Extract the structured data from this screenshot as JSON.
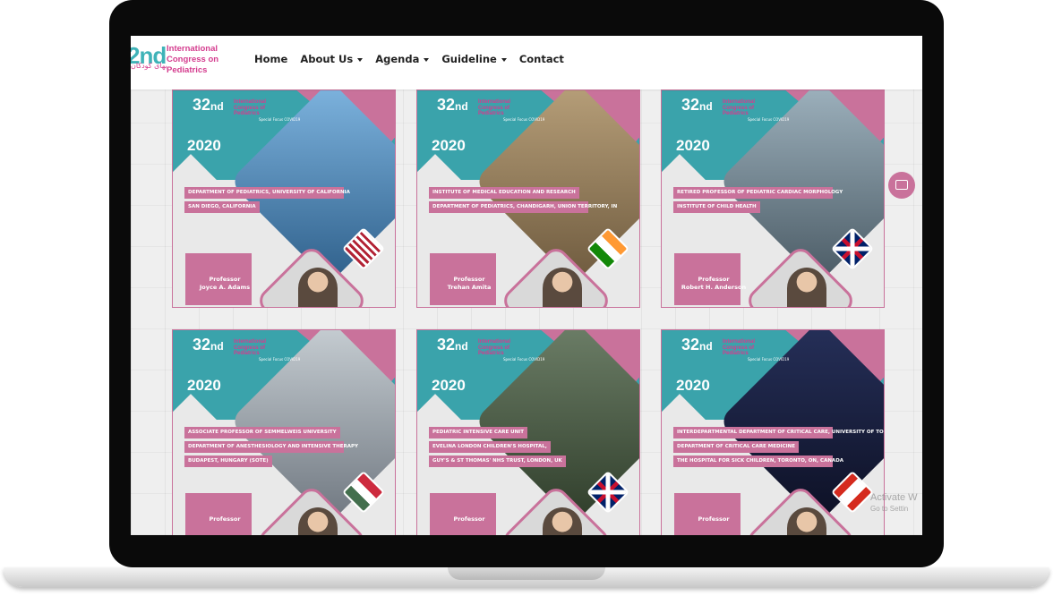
{
  "logo": {
    "number": "2nd",
    "en_lines": "International Congress on Pediatrics",
    "fa_lines": "سی و دومین کنگره بین المللی بیماریهای کودکان"
  },
  "nav": {
    "items": [
      {
        "label": "Home",
        "dropdown": false
      },
      {
        "label": "About Us",
        "dropdown": true
      },
      {
        "label": "Agenda",
        "dropdown": true
      },
      {
        "label": "Guideline",
        "dropdown": true
      },
      {
        "label": "Contact",
        "dropdown": false
      }
    ]
  },
  "cards": [
    {
      "number": "32",
      "ord": "nd",
      "year": "2020",
      "conference": "International Congress of Pediatrics",
      "special": "Special Focus COVID19",
      "dept": [
        "DEPARTMENT OF PEDIATRICS, UNIVERSITY OF CALIFORNIA",
        "SAN DIEGO, CALIFORNIA"
      ],
      "professor_title": "Professor",
      "professor_name": "Joyce A. Adams",
      "flag": "usa-flag",
      "photo_colors": [
        "#7fb5e0",
        "#2e5f8a"
      ]
    },
    {
      "number": "32",
      "ord": "nd",
      "year": "2020",
      "conference": "International Congress of Pediatrics",
      "special": "Special Focus COVID19",
      "dept": [
        "INSTITUTE OF MEDICAL EDUCATION AND RESEARCH",
        "DEPARTMENT OF PEDIATRICS, CHANDIGARH, UNION TERRITORY, IN"
      ],
      "professor_title": "Professor",
      "professor_name": "Trehan Amita",
      "flag": "india-flag",
      "photo_colors": [
        "#b8a07a",
        "#6e5a3e"
      ]
    },
    {
      "number": "32",
      "ord": "nd",
      "year": "2020",
      "conference": "International Congress of Pediatrics",
      "special": "Special Focus COVID19",
      "dept": [
        "RETIRED PROFESSOR OF PEDIATRIC CARDIAC MORPHOLOGY",
        "INSTITUTE OF CHILD HEALTH"
      ],
      "professor_title": "Professor",
      "professor_name": "Robert H. Anderson",
      "flag": "uk-flag",
      "photo_colors": [
        "#9fb3bf",
        "#4a5a64"
      ]
    },
    {
      "number": "32",
      "ord": "nd",
      "year": "2020",
      "conference": "International Congress of Pediatrics",
      "special": "Special Focus COVID19",
      "dept": [
        "ASSOCIATE PROFESSOR OF SEMMELWEIS UNIVERSITY",
        "DEPARTMENT OF ANESTHESIOLOGY AND INTENSIVE THERAPY",
        "BUDAPEST, HUNGARY (SOTE)"
      ],
      "professor_title": "Professor",
      "professor_name": "",
      "flag": "hungary-flag",
      "photo_colors": [
        "#c8cfd4",
        "#6f7780"
      ]
    },
    {
      "number": "32",
      "ord": "nd",
      "year": "2020",
      "conference": "International Congress of Pediatrics",
      "special": "Special Focus COVID19",
      "dept": [
        "PEDIATRIC INTENSIVE CARE UNIT",
        "EVELINA LONDON CHILDREN'S HOSPITAL,",
        "GUY'S & ST THOMAS' NHS TRUST, LONDON, UK"
      ],
      "professor_title": "Professor",
      "professor_name": "",
      "flag": "uk-flag",
      "photo_colors": [
        "#6d7f68",
        "#2f3d2a"
      ]
    },
    {
      "number": "32",
      "ord": "nd",
      "year": "2020",
      "conference": "International Congress of Pediatrics",
      "special": "Special Focus COVID19",
      "dept": [
        "INTERDEPARTMENTAL DEPARTMENT OF CRITICAL CARE, UNIVERSITY OF TORONTO",
        "DEPARTMENT OF CRITICAL CARE MEDICINE",
        "THE HOSPITAL FOR SICK CHILDREN, TORONTO, ON, CANADA"
      ],
      "professor_title": "Professor",
      "professor_name": "",
      "flag": "canada-flag",
      "photo_colors": [
        "#26305a",
        "#0d1024"
      ]
    }
  ],
  "watermark": {
    "line1": "Activate W",
    "line2": "Go to Settin"
  }
}
